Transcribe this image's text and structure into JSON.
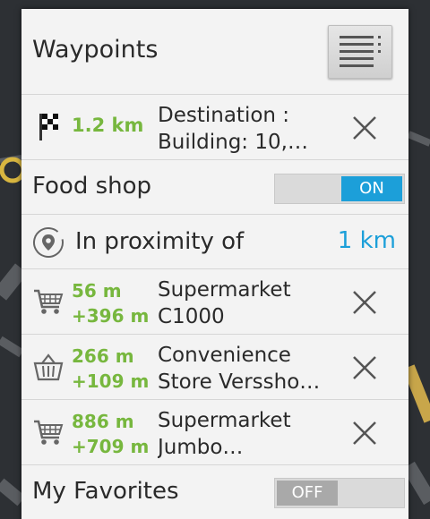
{
  "header": {
    "title": "Waypoints",
    "menu_icon": "list-menu-icon"
  },
  "destination": {
    "icon": "checkered-flag-icon",
    "distance": "1.2 km",
    "name_line1": "Destination :",
    "name_line2": "Building: 10,…"
  },
  "food_shop": {
    "label": "Food shop",
    "toggle": "ON"
  },
  "proximity": {
    "label": "In proximity of",
    "value": "1 km",
    "icon": "location-pin-icon"
  },
  "shops": [
    {
      "icon": "shopping-cart-icon",
      "dist": "56 m",
      "extra": "+396 m",
      "line1": "Supermarket",
      "line2": "C1000"
    },
    {
      "icon": "shopping-basket-icon",
      "dist": "266 m",
      "extra": "+109 m",
      "line1": "Convenience",
      "line2": "Store Verssho…"
    },
    {
      "icon": "shopping-cart-icon",
      "dist": "886 m",
      "extra": "+709 m",
      "line1": "Supermarket",
      "line2": "Jumbo…"
    }
  ],
  "favorites": {
    "label": "My Favorites",
    "toggle": "OFF"
  },
  "colors": {
    "accent": "#1c9fd9",
    "distance": "#77b73e",
    "panel": "#f3f3f3"
  }
}
